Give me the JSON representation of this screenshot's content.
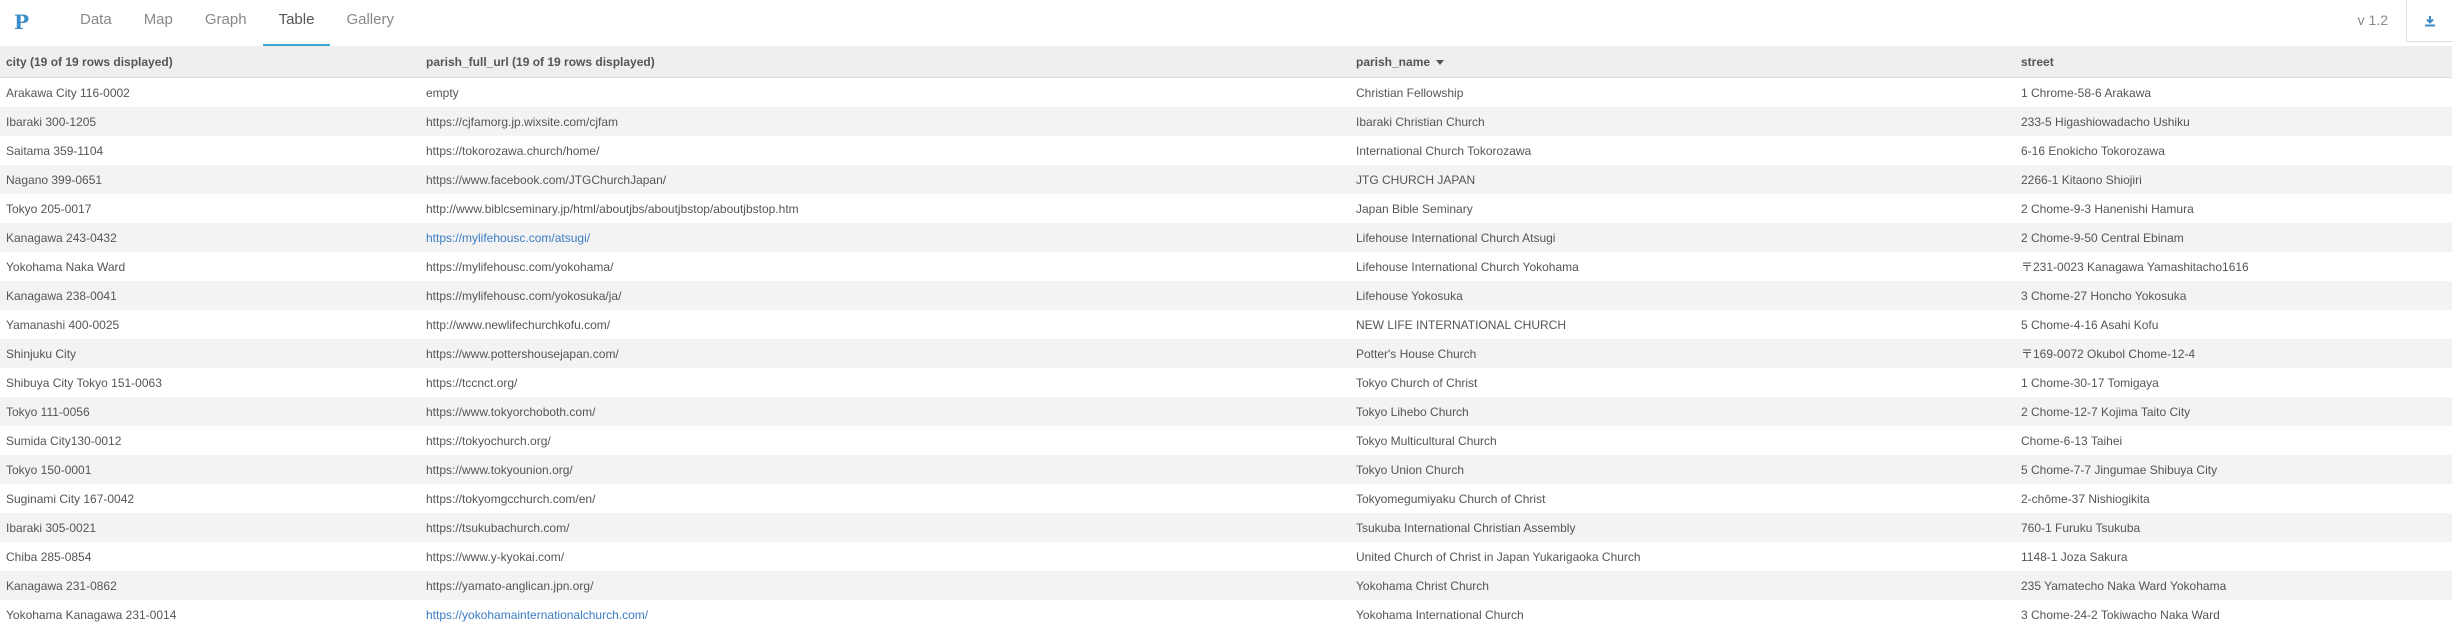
{
  "app": {
    "logo": "P",
    "version": "v 1.2"
  },
  "nav": {
    "tabs": [
      "Data",
      "Map",
      "Graph",
      "Table",
      "Gallery"
    ],
    "active": "Table"
  },
  "colors": {
    "accent": "#3ba8d0",
    "link": "#3a7cc4"
  },
  "table": {
    "headers": [
      "city (19 of 19 rows displayed)",
      "parish_full_url (19 of 19 rows displayed)",
      "parish_name",
      "street"
    ],
    "sorted_column": "parish_name",
    "rows": [
      [
        "Arakawa City 116-0002",
        "empty",
        "Christian Fellowship",
        "1 Chrome-58-6 Arakawa"
      ],
      [
        "Ibaraki 300-1205",
        "https://cjfamorg.jp.wixsite.com/cjfam",
        "Ibaraki Christian Church",
        "233-5 Higashiowadacho Ushiku"
      ],
      [
        "Saitama 359-1104",
        "https://tokorozawa.church/home/",
        "International Church Tokorozawa",
        "6-16 Enokicho Tokorozawa"
      ],
      [
        "Nagano 399-0651",
        "https://www.facebook.com/JTGChurchJapan/",
        "JTG CHURCH JAPAN",
        "2266-1 Kitaono Shiojiri"
      ],
      [
        "Tokyo 205-0017",
        "http://www.biblcseminary.jp/html/aboutjbs/aboutjbstop/aboutjbstop.htm",
        "Japan Bible Seminary",
        "2 Chome-9-3 Hanenishi Hamura"
      ],
      [
        "Kanagawa 243-0432",
        "https://mylifehousc.com/atsugi/",
        "Lifehouse International Church Atsugi",
        "2 Chome-9-50 Central Ebinam"
      ],
      [
        "Yokohama Naka Ward",
        "https://mylifehousc.com/yokohama/",
        "Lifehouse International Church Yokohama",
        "〒231-0023 Kanagawa Yamashitacho1616"
      ],
      [
        "Kanagawa 238-0041",
        "https://mylifehousc.com/yokosuka/ja/",
        "Lifehouse Yokosuka",
        "3 Chome-27 Honcho Yokosuka"
      ],
      [
        "Yamanashi 400-0025",
        "http://www.newlifechurchkofu.com/",
        "NEW LIFE INTERNATIONAL CHURCH",
        "5 Chome-4-16 Asahi Kofu"
      ],
      [
        "Shinjuku City",
        "https://www.pottershousejapan.com/",
        "Potter's House Church",
        "〒169-0072 Okubol Chome-12-4"
      ],
      [
        "Shibuya City Tokyo 151-0063",
        "https://tccnct.org/",
        "Tokyo Church of Christ",
        "1 Chome-30-17 Tomigaya"
      ],
      [
        "Tokyo 111-0056",
        "https://www.tokyorchoboth.com/",
        "Tokyo Lihebo Church",
        "2 Chome-12-7 Kojima Taito City"
      ],
      [
        "Sumida City130-0012",
        "https://tokyochurch.org/",
        "Tokyo Multicultural Church",
        "Chome-6-13 Taihei"
      ],
      [
        "Tokyo 150-0001",
        "https://www.tokyounion.org/",
        "Tokyo Union Church",
        "5 Chome-7-7 Jingumae Shibuya City"
      ],
      [
        "Suginami City 167-0042",
        "https://tokyomgcchurch.com/en/",
        "Tokyomegumiyaku Church of Christ",
        "2-chōme-37 Nishiogikita"
      ],
      [
        "Ibaraki 305-0021",
        "https://tsukubachurch.com/",
        "Tsukuba International Christian Assembly",
        "760-1 Furuku Tsukuba"
      ],
      [
        "Chiba 285-0854",
        "https://www.y-kyokai.com/",
        "United Church of Christ in Japan Yukarigaoka Church",
        "1148-1 Joza Sakura"
      ],
      [
        "Kanagawa 231-0862",
        "https://yamato-anglican.jpn.org/",
        "Yokohama Christ Church",
        "235 Yamatecho Naka Ward Yokohama"
      ],
      [
        "Yokohama Kanagawa 231-0014",
        "https://yokohamainternationalchurch.com/",
        "Yokohama International Church",
        "3 Chome-24-2 Tokiwacho Naka Ward"
      ]
    ],
    "link_rows": [
      5,
      18
    ]
  }
}
